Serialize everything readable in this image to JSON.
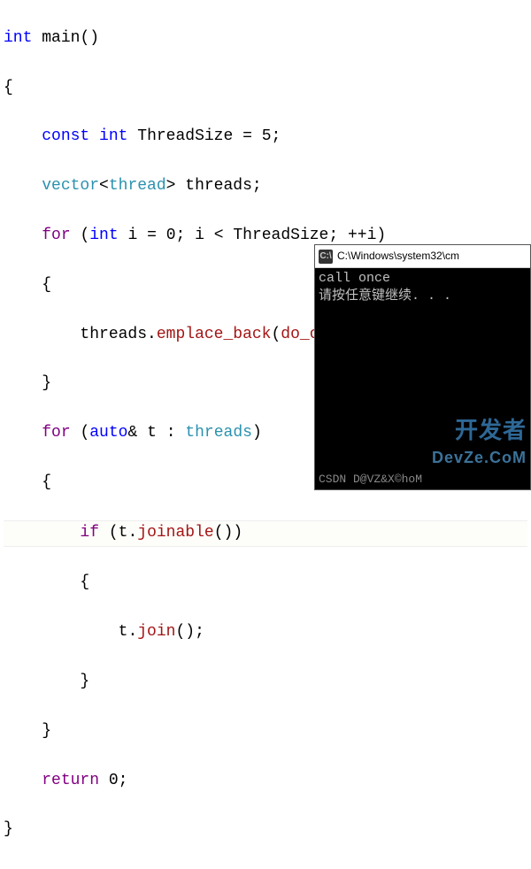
{
  "code": {
    "ret_type": "int",
    "main": "main",
    "lparen": "(",
    "rparen": ")",
    "lbrace": "{",
    "rbrace": "}",
    "const_kw": "const",
    "int_kw": "int",
    "threadsize_var": "ThreadSize",
    "eq": " = ",
    "five": "5",
    "semi": ";",
    "vector": "vector",
    "lt": "<",
    "gt": ">",
    "thread_type": "thread",
    "threads_var": "threads",
    "for_kw": "for",
    "sp": " ",
    "i_var": "i",
    "zero": "0",
    "lt_op": " < ",
    "inc": "++",
    "dot": ".",
    "emplace_back": "emplace_back",
    "do_once": "do_once",
    "auto_kw": "auto",
    "amp": "&",
    "t_var": "t",
    "colon": " : ",
    "if_kw": "if",
    "joinable": "joinable",
    "join": "join",
    "return_kw": "return"
  },
  "console": {
    "title_icon": "C:\\",
    "title": "C:\\Windows\\system32\\cm",
    "line1": "call once",
    "line2": "请按任意键继续. . ."
  },
  "watermark": {
    "top": "开发者",
    "bottom": "DevZe.CoM",
    "csdn": "CSDN D@VZ&X©hoM"
  }
}
